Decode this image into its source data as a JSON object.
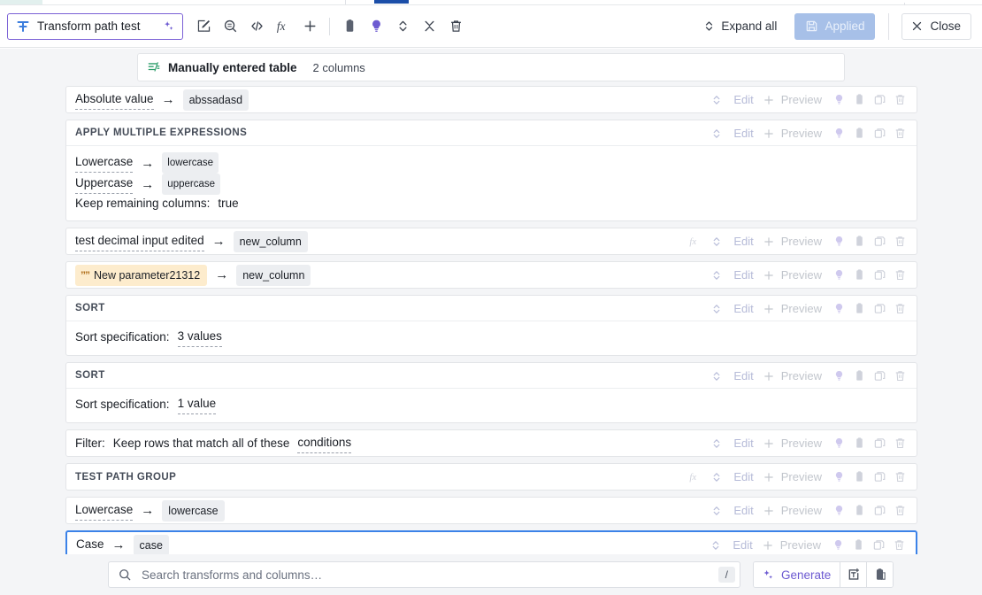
{
  "toolbar": {
    "title": "Transform path test",
    "title_icon": "transform-icon",
    "sparkle_icon": "sparkles-icon",
    "buttons": [
      {
        "name": "edit-icon",
        "label": "Edit"
      },
      {
        "name": "search-data-icon",
        "label": "Search data"
      },
      {
        "name": "code-icon",
        "label": "Code"
      },
      {
        "name": "formula-icon",
        "label": "fx"
      },
      {
        "name": "add-icon",
        "label": "Add"
      },
      {
        "name": "clipboard-icon",
        "label": "Paste"
      },
      {
        "name": "lightbulb-icon",
        "label": "Suggestions"
      },
      {
        "name": "sort-icon",
        "label": "Reorder"
      },
      {
        "name": "collapse-icon",
        "label": "Collapse"
      },
      {
        "name": "trash-icon",
        "label": "Delete"
      }
    ],
    "expand_all_label": "Expand all",
    "applied_label": "Applied",
    "applied_icon": "save-icon",
    "close_label": "Close",
    "close_icon": "close-icon",
    "accent_purple": "#6c5ad1",
    "accent_blue": "#3b82e8",
    "applied_bg": "#a7c0e8"
  },
  "source": {
    "icon": "manual-table-icon",
    "name": "Manually entered table",
    "meta": "2 columns"
  },
  "actions": {
    "reorder_icon": "sort-updown-icon",
    "edit_label": "Edit",
    "preview_plus_icon": "plus-icon",
    "preview_label": "Preview",
    "lightbulb_icon": "lightbulb-icon",
    "clipboard_icon": "clipboard-icon",
    "duplicate_icon": "duplicate-icon",
    "trash_icon": "trash-icon",
    "fx_icon": "formula-icon"
  },
  "rows": [
    {
      "id": "absolute-value",
      "kind": "simple",
      "has_fx": false,
      "selected": false,
      "head": [
        {
          "type": "dashed",
          "text": "Absolute value"
        },
        {
          "type": "arrow",
          "text": "→"
        },
        {
          "type": "chip",
          "text": "abssadasd"
        }
      ]
    },
    {
      "id": "apply-multiple-expressions",
      "kind": "group",
      "has_fx": false,
      "selected": false,
      "group_label": "APPLY MULTIPLE EXPRESSIONS",
      "body": [
        [
          {
            "type": "dashed",
            "text": "Lowercase"
          },
          {
            "type": "arrow",
            "text": "→"
          },
          {
            "type": "chip-sm",
            "text": "lowercase"
          }
        ],
        [
          {
            "type": "dashed",
            "text": "Uppercase"
          },
          {
            "type": "arrow",
            "text": "→"
          },
          {
            "type": "chip-sm",
            "text": "uppercase"
          }
        ],
        [
          {
            "type": "plain",
            "text": "Keep remaining columns:"
          },
          {
            "type": "plain",
            "text": "true"
          }
        ]
      ]
    },
    {
      "id": "test-decimal-input-edited",
      "kind": "simple",
      "has_fx": true,
      "selected": false,
      "head": [
        {
          "type": "dashed",
          "text": "test decimal input edited"
        },
        {
          "type": "arrow",
          "text": "→"
        },
        {
          "type": "chip",
          "text": "new_column"
        }
      ]
    },
    {
      "id": "new-parameter21312",
      "kind": "simple",
      "has_fx": false,
      "selected": false,
      "head": [
        {
          "type": "param",
          "text": "New parameter21312",
          "quote": "””"
        },
        {
          "type": "arrow",
          "text": "→"
        },
        {
          "type": "chip",
          "text": "new_column"
        }
      ]
    },
    {
      "id": "sort-3-values",
      "kind": "group",
      "has_fx": false,
      "selected": false,
      "group_label": "SORT",
      "body": [
        [
          {
            "type": "plain",
            "text": "Sort specification:"
          },
          {
            "type": "dashed",
            "text": "3 values"
          }
        ]
      ]
    },
    {
      "id": "sort-1-value",
      "kind": "group",
      "has_fx": false,
      "selected": false,
      "group_label": "SORT",
      "body": [
        [
          {
            "type": "plain",
            "text": "Sort specification:"
          },
          {
            "type": "dashed",
            "text": "1 value"
          }
        ]
      ]
    },
    {
      "id": "filter",
      "kind": "simple",
      "has_fx": false,
      "selected": false,
      "head": [
        {
          "type": "plain",
          "text": "Filter:"
        },
        {
          "type": "plain",
          "text": "Keep rows that match all of these"
        },
        {
          "type": "dashed",
          "text": "conditions"
        }
      ]
    },
    {
      "id": "test-path-group",
      "kind": "label-only",
      "has_fx": true,
      "selected": false,
      "group_label": "TEST PATH GROUP"
    },
    {
      "id": "lowercase",
      "kind": "simple",
      "has_fx": false,
      "selected": false,
      "head": [
        {
          "type": "dashed",
          "text": "Lowercase"
        },
        {
          "type": "arrow",
          "text": "→"
        },
        {
          "type": "chip",
          "text": "lowercase"
        }
      ]
    },
    {
      "id": "case",
      "kind": "simple",
      "has_fx": false,
      "selected": true,
      "head": [
        {
          "type": "dashed",
          "text": "Case"
        },
        {
          "type": "arrow",
          "text": "→"
        },
        {
          "type": "chip",
          "text": "case"
        }
      ]
    }
  ],
  "bottom": {
    "search_icon": "search-icon",
    "search_value": "",
    "search_placeholder": "Search transforms and columns…",
    "shortcut": "/",
    "generate_label": "Generate",
    "generate_icon": "sparkles-icon",
    "text_tool_icon": "text-insert-icon",
    "paste_icon": "clipboard-paste-icon"
  }
}
